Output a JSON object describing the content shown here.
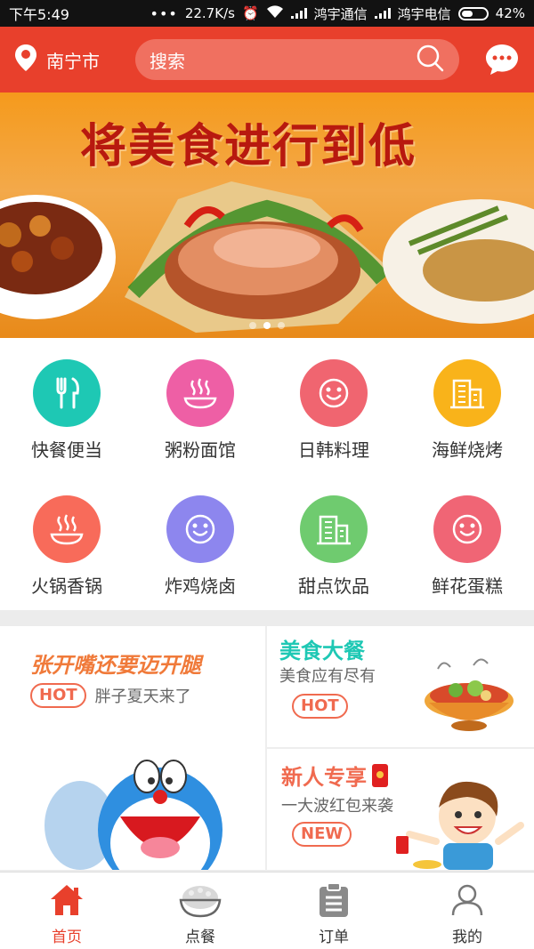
{
  "status_bar": {
    "time": "下午5:49",
    "speed": "22.7K/s",
    "carrier1": "鸿宇通信",
    "carrier2": "鸿宇电信",
    "battery": "42%"
  },
  "header": {
    "city": "南宁市",
    "search_placeholder": "搜索"
  },
  "banner": {
    "title": "将美食进行到低",
    "slide_count": 3,
    "active_slide": 1
  },
  "categories": [
    {
      "label": "快餐便当",
      "color": "#1ec8b4",
      "icon": "fork-knife-icon"
    },
    {
      "label": "粥粉面馆",
      "color": "#ee5fa5",
      "icon": "hot-bowl-icon"
    },
    {
      "label": "日韩料理",
      "color": "#f06570",
      "icon": "smile-icon"
    },
    {
      "label": "海鲜烧烤",
      "color": "#f9b31a",
      "icon": "building-icon"
    },
    {
      "label": "火锅香锅",
      "color": "#f86b5a",
      "icon": "hot-bowl-icon"
    },
    {
      "label": "炸鸡烧卤",
      "color": "#8d86ee",
      "icon": "smile-icon"
    },
    {
      "label": "甜点饮品",
      "color": "#6fcb6f",
      "icon": "building-icon"
    },
    {
      "label": "鲜花蛋糕",
      "color": "#f06575",
      "icon": "smile-icon"
    }
  ],
  "promo": {
    "left": {
      "title": "张开嘴还要迈开腿",
      "badge": "HOT",
      "subtitle": "胖子夏天来了"
    },
    "top_right": {
      "title": "美食大餐",
      "subtitle": "美食应有尽有",
      "badge": "HOT"
    },
    "bottom_right": {
      "title": "新人专享",
      "subtitle": "一大波红包来袭",
      "badge": "NEW"
    }
  },
  "tabs": [
    {
      "label": "首页",
      "icon": "home-icon",
      "active": true
    },
    {
      "label": "点餐",
      "icon": "rice-bowl-icon",
      "active": false
    },
    {
      "label": "订单",
      "icon": "clipboard-icon",
      "active": false
    },
    {
      "label": "我的",
      "icon": "user-icon",
      "active": false
    }
  ],
  "colors": {
    "brand": "#e8402c",
    "title_teal": "#1ec8b4",
    "title_orange": "#f06a4f"
  }
}
